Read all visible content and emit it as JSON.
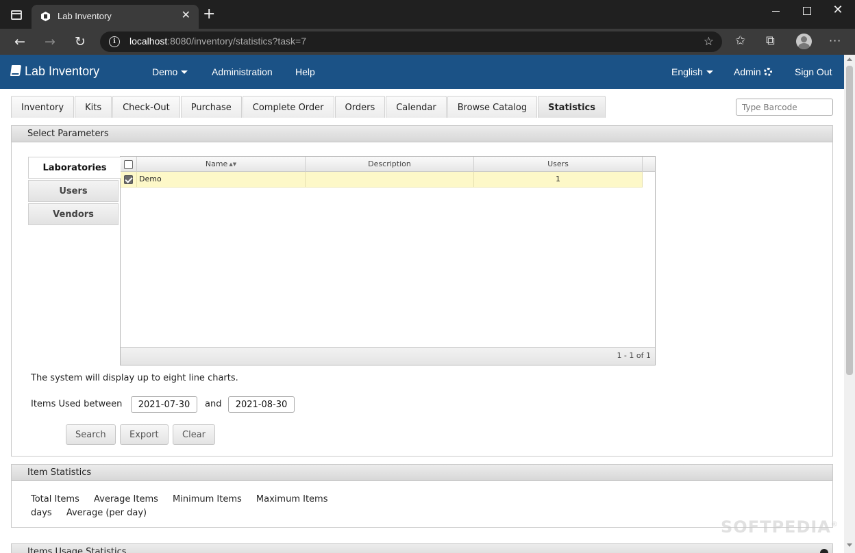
{
  "browser": {
    "tab_title": "Lab Inventory",
    "url_host": "localhost",
    "url_rest": ":8080/inventory/statistics?task=7"
  },
  "app": {
    "brand": "Lab Inventory",
    "menu": {
      "demo": "Demo",
      "administration": "Administration",
      "help": "Help",
      "language": "English",
      "admin": "Admin",
      "signout": "Sign Out"
    },
    "colors": {
      "header": "#1b5286",
      "selected_row": "#fdf8c8"
    }
  },
  "tabs": [
    "Inventory",
    "Kits",
    "Check-Out",
    "Purchase",
    "Complete Order",
    "Orders",
    "Calendar",
    "Browse Catalog",
    "Statistics"
  ],
  "active_tab": "Statistics",
  "barcode": {
    "placeholder": "Type Barcode"
  },
  "params": {
    "title": "Select Parameters",
    "side_tabs": [
      "Laboratories",
      "Users",
      "Vendors"
    ],
    "grid": {
      "columns": {
        "name": "Name",
        "description": "Description",
        "users": "Users"
      },
      "rows": [
        {
          "checked": true,
          "name": "Demo",
          "description": "",
          "users": "1"
        }
      ],
      "pager": "1 - 1 of 1"
    },
    "note": "The system will display up to eight line charts.",
    "range_label": "Items Used between",
    "and_label": "and",
    "date_from": "2021-07-30",
    "date_to": "2021-08-30",
    "buttons": {
      "search": "Search",
      "export": "Export",
      "clear": "Clear"
    }
  },
  "item_stats": {
    "title": "Item Statistics",
    "row1": [
      "Total Items",
      "Average Items",
      "Minimum Items",
      "Maximum Items"
    ],
    "row2": [
      "days",
      "Average (per day)"
    ]
  },
  "usage_stats": {
    "title": "Items Usage Statistics"
  },
  "watermark": "SOFTPEDIA"
}
